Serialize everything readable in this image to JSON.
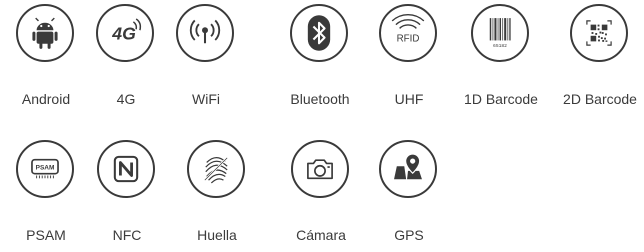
{
  "features_row1": [
    {
      "label": "Android",
      "icon": "android-icon"
    },
    {
      "label": "4G",
      "icon": "4g-icon"
    },
    {
      "label": "WiFi",
      "icon": "wifi-icon"
    },
    {
      "label": "Bluetooth",
      "icon": "bluetooth-icon"
    },
    {
      "label": "UHF",
      "icon": "rfid-icon"
    },
    {
      "label": "1D Barcode",
      "icon": "barcode-1d-icon"
    },
    {
      "label": "2D Barcode",
      "icon": "barcode-2d-icon"
    }
  ],
  "features_row2": [
    {
      "label": "PSAM",
      "icon": "psam-card-icon"
    },
    {
      "label": "NFC",
      "icon": "nfc-icon"
    },
    {
      "label": "Huella",
      "icon": "fingerprint-icon"
    },
    {
      "label": "Cámara",
      "icon": "camera-icon"
    },
    {
      "label": "GPS",
      "icon": "map-pin-icon"
    }
  ],
  "icon_text": {
    "four_g": "4G",
    "rfid": "RFID",
    "barcode_number": "65182",
    "psam": "PSAM"
  },
  "colors": {
    "icon": "#3a3a3a",
    "label": "#3b3b3b",
    "background": "#ffffff"
  }
}
